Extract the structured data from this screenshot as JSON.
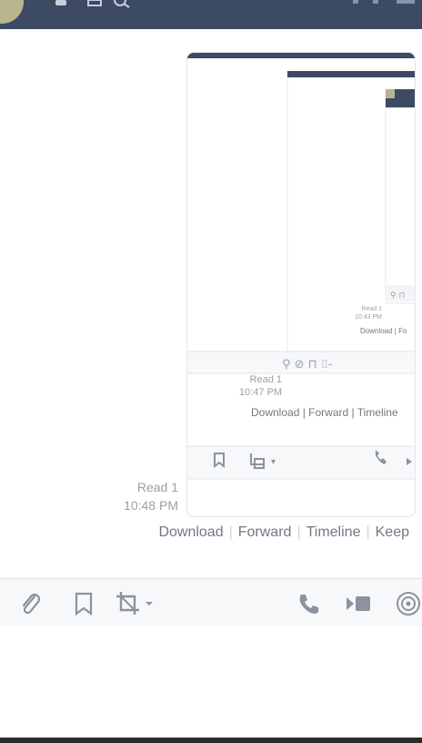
{
  "message": {
    "read_status": "Read 1",
    "time": "10:48 PM"
  },
  "actions": [
    "Download",
    "Forward",
    "Timeline",
    "Keep"
  ],
  "nested_1": {
    "read_status": "Read 1",
    "time": "10:47 PM",
    "actions": [
      "Download",
      "Forward",
      "Timeline"
    ]
  },
  "nested_2": {
    "read_status": "Read 1",
    "time": "10:43 PM",
    "actions": [
      "Download",
      "Fo"
    ]
  },
  "toolbar": {
    "icons": [
      "paperclip-icon",
      "bookmark-icon",
      "crop-icon",
      "phone-icon",
      "video-icon",
      "broadcast-icon"
    ]
  },
  "colors": {
    "header": "#3d4a63",
    "accent_gray": "#8c939d"
  }
}
